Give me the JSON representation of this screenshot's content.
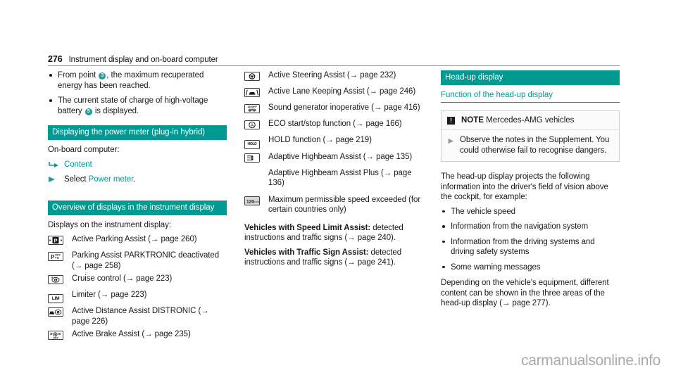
{
  "header": {
    "page_number": "276",
    "chapter": "Instrument display and on-board computer"
  },
  "column_left": {
    "bullets": [
      {
        "pre": "From point ",
        "badge": "3",
        "post": ", the maximum recuperated energy has been reached."
      },
      {
        "pre": "The current state of charge of high-voltage battery ",
        "badge": "5",
        "post": " is displayed."
      }
    ],
    "section1": {
      "title": "Displaying the power meter (plug-in hybrid)",
      "lead": "On-board computer:",
      "steps": [
        {
          "icon": "menu-path-arrow-icon",
          "label": "Content",
          "teal": true
        },
        {
          "icon": "triangle-play-icon",
          "label_plain": "Select ",
          "label_teal": "Power meter",
          "tail": "."
        }
      ]
    },
    "section2": {
      "title": "Overview of displays in the instrument display",
      "lead": "Displays on the instrument display:",
      "rows": [
        {
          "icon": "active-parking-assist-icon",
          "text": "Active Parking Assist (→ page 260)"
        },
        {
          "icon": "parktronic-deactivated-icon",
          "text": "Parking Assist PARKTRONIC deactivated (→ page 258)"
        },
        {
          "icon": "cruise-control-icon",
          "text": "Cruise control (→ page 223)"
        },
        {
          "icon": "limiter-icon",
          "text": "Limiter (→ page 223)"
        },
        {
          "icon": "distronic-icon",
          "text": "Active Distance Assist DISTRONIC (→ page 226)"
        },
        {
          "icon": "active-brake-assist-icon",
          "text": "Active Brake Assist (→ page 235)"
        }
      ]
    }
  },
  "column_middle": {
    "rows": [
      {
        "icon": "active-steering-assist-icon",
        "text": "Active Steering Assist (→ page 232)"
      },
      {
        "icon": "lane-keeping-assist-icon",
        "text": "Active Lane Keeping Assist (→ page 246)"
      },
      {
        "icon": "sound-generator-icon",
        "text": "Sound generator inoperative (→ page 416)"
      },
      {
        "icon": "eco-start-stop-icon",
        "text": "ECO start/stop function (→ page 166)"
      },
      {
        "icon": "hold-function-icon",
        "text": "HOLD function (→ page 219)"
      },
      {
        "icon": "adaptive-highbeam-icon",
        "text": "Adaptive Highbeam Assist (→ page 135)"
      },
      {
        "icon": "none",
        "text": "Adaptive Highbeam Assist Plus (→ page 136)"
      },
      {
        "icon": "max-speed-exceeded-icon",
        "text": "Maximum permissible speed exceeded (for certain countries only)"
      }
    ],
    "paragraphs": [
      {
        "bold": "Vehicles with Speed Limit Assist:",
        "rest": " detected instructions and traffic signs (→ page 240)."
      },
      {
        "bold": "Vehicles with Traffic Sign Assist:",
        "rest": " detected instructions and traffic signs (→ page 241)."
      }
    ]
  },
  "column_right": {
    "section_title": "Head-up display",
    "subsection_title": "Function of the head-up display",
    "note": {
      "icon_glyph": "!",
      "label": "NOTE",
      "title": " Mercedes-AMG vehicles",
      "body": "Observe the notes in the Supplement. You could otherwise fail to recognise dangers."
    },
    "intro": "The head-up display projects the following information into the driver's field of vision above the cockpit, for example:",
    "bullets": [
      "The vehicle speed",
      "Information from the navigation system",
      "Information from the driving systems and driving safety systems",
      "Some warning messages"
    ],
    "outro": "Depending on the vehicle's equipment, different content can be shown in the three areas of the head-up display (→ page 277)."
  },
  "watermark": "carmanualsonline.info",
  "colors": {
    "teal": "#009a92",
    "badge_teal": "#1c9c9c",
    "text": "#1a1a1a",
    "watermark": "#a9a9a9"
  }
}
